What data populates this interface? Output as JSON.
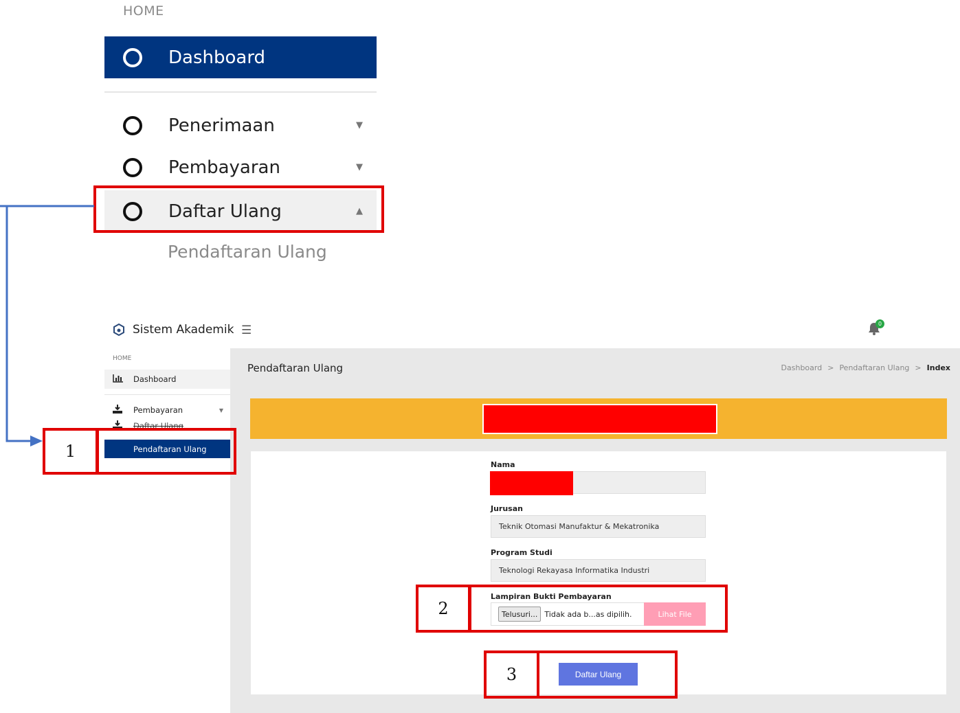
{
  "zoom_sidebar": {
    "section": "HOME",
    "dashboard": "Dashboard",
    "penerimaan": "Penerimaan",
    "pembayaran": "Pembayaran",
    "daftar_ulang": "Daftar Ulang",
    "sub_item": "Pendaftaran Ulang"
  },
  "annotations": {
    "one": "1",
    "two": "2",
    "three": "3",
    "box_color": "#e00000",
    "arrow_color": "#4472c4"
  },
  "app": {
    "title": "Sistem Akademik",
    "notification_count": "0",
    "sidebar": {
      "section": "HOME",
      "dashboard": "Dashboard",
      "pembayaran": "Pembayaran",
      "daftar_ulang": "Daftar Ulang",
      "pendaftaran_ulang": "Pendaftaran Ulang"
    },
    "page_title": "Pendaftaran Ulang",
    "breadcrumb": [
      "Dashboard",
      "Pendaftaran Ulang",
      "Index"
    ],
    "breadcrumb_separator": ">",
    "form": {
      "nama_label": "Nama",
      "jurusan_label": "Jurusan",
      "jurusan_value": "Teknik Otomasi Manufaktur & Mekatronika",
      "prodi_label": "Program Studi",
      "prodi_value": "Teknologi Rekayasa Informatika Industri",
      "lampiran_label": "Lampiran Bukti Pembayaran",
      "browse_button": "Telusuri...",
      "file_status": "Tidak ada b...as dipilih.",
      "view_file_button": "Lihat File",
      "submit_button": "Daftar Ulang"
    },
    "colors": {
      "primary": "#003580",
      "banner": "#f5b32f",
      "submit": "#5f75e0",
      "view_file": "#ff9eb5",
      "badge": "#28a745",
      "redaction": "#ff0000"
    }
  }
}
